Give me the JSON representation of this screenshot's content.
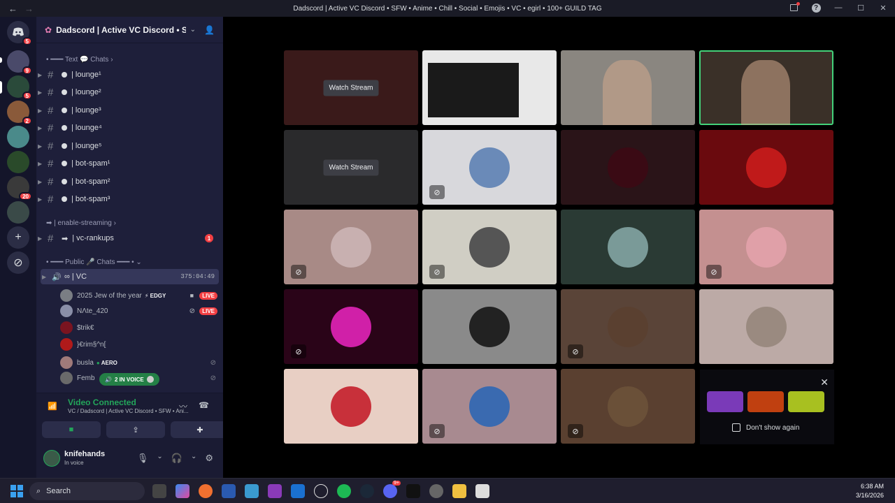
{
  "window": {
    "title": "Dadscord | Active VC Discord • SFW • Anime • Chill • Social • Emojis • VC • egirl • 100+ GUILD TAG"
  },
  "rail": {
    "badges": [
      "5",
      "9",
      "5",
      "2",
      "20"
    ]
  },
  "guild": {
    "name": "Dadscord | Active VC Discord • S..."
  },
  "sidebar": {
    "categories": {
      "text": "Text 💬 Chats",
      "streaming": "| enable-streaming",
      "public": "Public 🎤 Chats"
    },
    "channels": [
      {
        "label": "| lounge¹"
      },
      {
        "label": "| lounge²"
      },
      {
        "label": "| lounge³"
      },
      {
        "label": "| lounge⁴"
      },
      {
        "label": "| lounge⁵"
      },
      {
        "label": "| bot-spam¹"
      },
      {
        "label": "| bot-spam²"
      },
      {
        "label": "| bot-spam³"
      }
    ],
    "rankups": {
      "label": "| vc-rankups",
      "mentions": "1"
    },
    "voice_channel": {
      "label": "∞ | VC",
      "timer": "375:04:49"
    },
    "members": [
      {
        "name": "2025 Jew of the year",
        "tag": "⚡ EDGY",
        "live": "LIVE",
        "color": "#7a7e84"
      },
      {
        "name": "NΛte_420",
        "live": "LIVE",
        "color": "#8a8fa8"
      },
      {
        "name": "$trik€",
        "color": "#7a1420"
      },
      {
        "name": "}€rim§^n[",
        "color": "#b01a1a"
      },
      {
        "name": "busla",
        "tag": "AERO",
        "color": "#a07a7a"
      },
      {
        "name": "Femb",
        "color": "#6a6a6a"
      }
    ],
    "in_voice": "2 IN VOICE"
  },
  "voice_panel": {
    "status": "Video Connected",
    "channel": "VC / Dadscord | Active VC Discord • SFW • Ani..."
  },
  "user": {
    "name": "knifehands",
    "status": "In voice"
  },
  "tiles": [
    {
      "kind": "stream",
      "label": "Watch Stream",
      "bg": "#3a1a1a"
    },
    {
      "kind": "screen",
      "bg": "#e8e8e8"
    },
    {
      "kind": "camera",
      "bg": "#8a8680"
    },
    {
      "kind": "camera",
      "bg": "#3a3028",
      "speaking": true
    },
    {
      "kind": "stream",
      "label": "Watch Stream",
      "bg": "#2a2a2c"
    },
    {
      "kind": "avatar",
      "bg": "#d8d8dc",
      "av": "#6a8ab8",
      "muted": true
    },
    {
      "kind": "avatar",
      "bg": "#2a1418",
      "av": "#3a0a14"
    },
    {
      "kind": "avatar",
      "bg": "#6a0a0e",
      "av": "#c01a1a"
    },
    {
      "kind": "avatar",
      "bg": "#a88a86",
      "av": "#c8b0b0",
      "muted": true
    },
    {
      "kind": "avatar",
      "bg": "#d0cec4",
      "av": "#555555",
      "muted": true
    },
    {
      "kind": "avatar",
      "bg": "#2a3a34",
      "av": "#7a9a98"
    },
    {
      "kind": "avatar",
      "bg": "#c49090",
      "av": "#e0a0a8",
      "muted": true
    },
    {
      "kind": "avatar",
      "bg": "#2a0418",
      "av": "#d020a8",
      "muted": true
    },
    {
      "kind": "avatar",
      "bg": "#8a8a8a",
      "av": "#222222"
    },
    {
      "kind": "avatar",
      "bg": "#5a4438",
      "av": "#5a4030",
      "muted": true
    },
    {
      "kind": "avatar",
      "bg": "#bcaaa6",
      "av": "#9a8a80"
    },
    {
      "kind": "avatar",
      "bg": "#e8cfc4",
      "av": "#c8303a"
    },
    {
      "kind": "avatar",
      "bg": "#a88a90",
      "av": "#3a6ab0",
      "muted": true
    },
    {
      "kind": "avatar",
      "bg": "#5a4030",
      "av": "#6a5038",
      "muted": true
    }
  ],
  "promo": {
    "dont_show": "Don't show again"
  },
  "taskbar": {
    "search": "Search",
    "discord_badge": "9+",
    "time": "6:38 AM",
    "date": "3/16/2026"
  },
  "colors": {
    "accent_green": "#23a55a",
    "live_red": "#f23f43",
    "speaking_outline": "#43d17a"
  }
}
